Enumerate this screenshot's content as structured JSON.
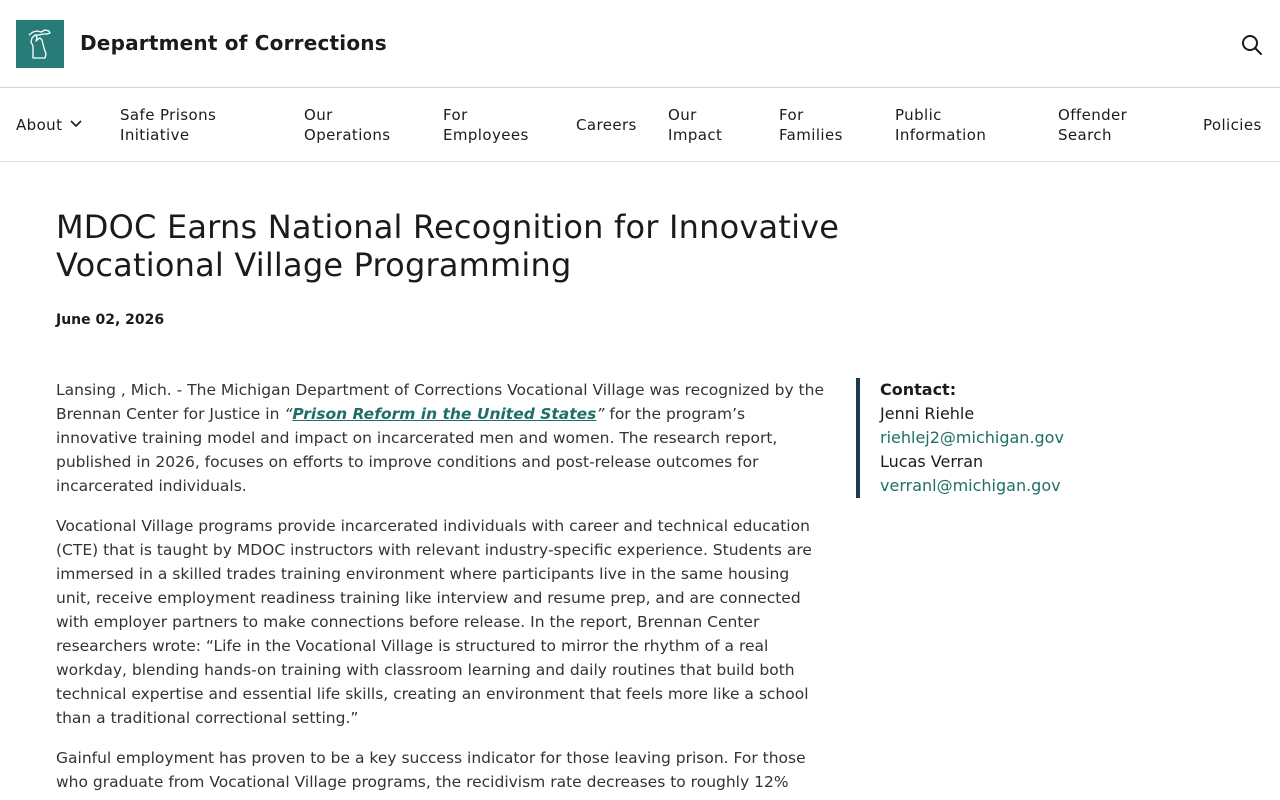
{
  "header": {
    "site_title": "Department of Corrections"
  },
  "nav": {
    "items": [
      {
        "label_lines": [
          "About"
        ],
        "has_dropdown": true
      },
      {
        "label_lines": [
          "Safe Prisons",
          "Initiative"
        ]
      },
      {
        "label_lines": [
          "Our",
          "Operations"
        ]
      },
      {
        "label_lines": [
          "For",
          "Employees"
        ]
      },
      {
        "label_lines": [
          "Careers"
        ]
      },
      {
        "label_lines": [
          "Our",
          "Impact"
        ]
      },
      {
        "label_lines": [
          "For",
          "Families"
        ]
      },
      {
        "label_lines": [
          "Public",
          "Information"
        ]
      },
      {
        "label_lines": [
          "Offender",
          "Search"
        ]
      },
      {
        "label_lines": [
          "Policies"
        ]
      }
    ]
  },
  "article": {
    "headline": "MDOC Earns National Recognition for Innovative Vocational Village Programming",
    "date": "June 02, 2026",
    "p1_before": "Lansing , Mich. - The Michigan Department of Corrections Vocational Village was recognized by the Brennan Center for Justice in ",
    "p1_open_quote": "“",
    "p1_link": "Prison Reform in the United States",
    "p1_close_quote": "”",
    "p1_after": " for the program’s innovative training model and impact on incarcerated men and women. The research report, published in 2026, focuses on efforts to improve conditions and post-release outcomes for incarcerated individuals.",
    "p2": "Vocational Village programs provide incarcerated individuals with career and technical education (CTE) that is taught by MDOC instructors with relevant industry-specific experience. Students are immersed in a skilled trades training environment where participants live in the same housing unit, receive employment readiness training like interview and resume prep, and are connected with employer partners to make connections before release. In the report, Brennan Center researchers wrote: “Life in the Vocational Village is structured to mirror the rhythm of a real workday, blending hands-on training with classroom learning and daily routines that build both technical expertise and essential life skills, creating an environment that feels more like a school than a traditional correctional setting.”",
    "p3": "Gainful employment has proven to be a key success indicator for those leaving prison. For those who graduate from Vocational Village programs, the recidivism rate decreases to roughly 12%"
  },
  "contact": {
    "label": "Contact:",
    "people": [
      {
        "name": "Jenni Riehle",
        "email": "riehlej2@michigan.gov"
      },
      {
        "name": "Lucas Verran",
        "email": "verranl@michigan.gov"
      }
    ]
  },
  "colors": {
    "brand_teal": "#277c78",
    "link_teal": "#1f6e6a",
    "contact_border": "#1d3b4f"
  },
  "icons": {
    "logo": "michigan-state-icon",
    "search": "search-icon",
    "dropdown": "chevron-down-icon"
  }
}
